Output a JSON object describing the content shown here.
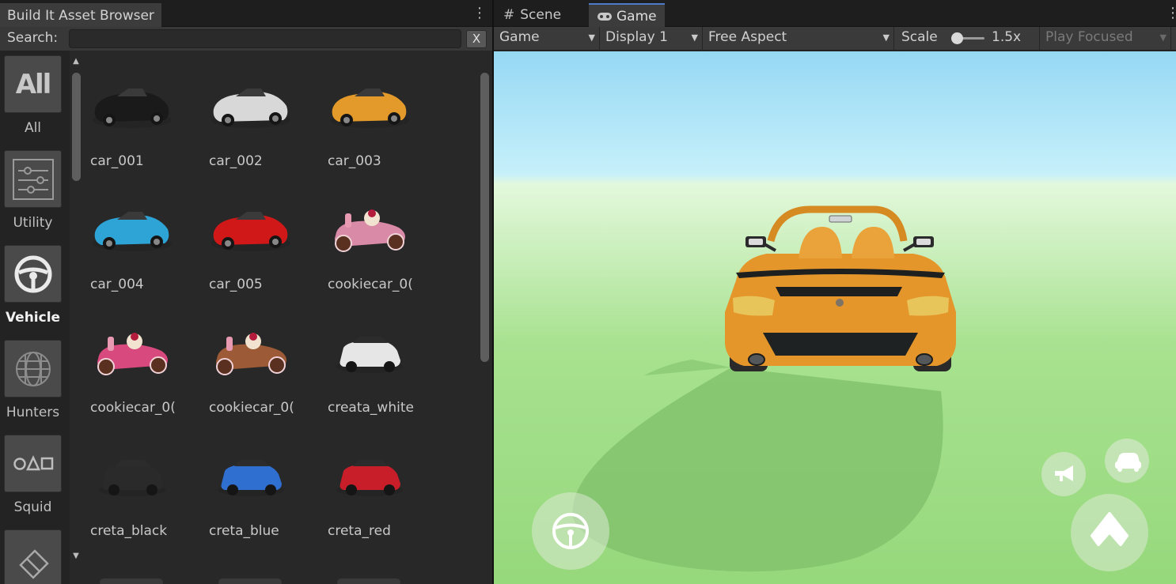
{
  "asset_browser": {
    "tab_title": "Build It Asset Browser",
    "search_label": "Search:",
    "search_value": "",
    "clear_label": "X",
    "categories": [
      {
        "label": "All",
        "icon": "all-text-icon",
        "icon_text": "All",
        "active": false
      },
      {
        "label": "Utility",
        "icon": "sliders-icon",
        "active": false
      },
      {
        "label": "Vehicle",
        "icon": "steering-wheel-icon",
        "active": true
      },
      {
        "label": "Hunters",
        "icon": "globe-grid-icon",
        "active": false
      },
      {
        "label": "Squid",
        "icon": "circle-triangle-square-icon",
        "active": false
      },
      {
        "label": "",
        "icon": "eraser-icon",
        "active": false
      }
    ],
    "assets": [
      {
        "name": "car_001",
        "body": "#1a1a1a",
        "kind": "roadster"
      },
      {
        "name": "car_002",
        "body": "#d8d8d8",
        "kind": "roadster"
      },
      {
        "name": "car_003",
        "body": "#e39a2a",
        "kind": "roadster"
      },
      {
        "name": "car_004",
        "body": "#2ea3d5",
        "kind": "roadster"
      },
      {
        "name": "car_005",
        "body": "#d01818",
        "kind": "roadster"
      },
      {
        "name": "cookiecar_0(",
        "body": "#d98aa6",
        "kind": "cookie"
      },
      {
        "name": "cookiecar_0(",
        "body": "#d84a7e",
        "kind": "cookie"
      },
      {
        "name": "cookiecar_0(",
        "body": "#9c5a36",
        "kind": "cookie"
      },
      {
        "name": "creata_white",
        "body": "#e6e6e6",
        "kind": "suv"
      },
      {
        "name": "creta_black",
        "body": "#2a2a2a",
        "kind": "suv"
      },
      {
        "name": "creta_blue",
        "body": "#2e6fd0",
        "kind": "suv"
      },
      {
        "name": "creta_red",
        "body": "#c81e2a",
        "kind": "suv"
      }
    ]
  },
  "game_view": {
    "tabs": [
      {
        "label": "Scene",
        "icon": "grid-hash-icon",
        "active": false
      },
      {
        "label": "Game",
        "icon": "gamepad-icon",
        "active": true
      }
    ],
    "toolbar": {
      "view_select": "Game",
      "display_select": "Display 1",
      "aspect_select": "Free Aspect",
      "scale_label": "Scale",
      "scale_value": "1.5x",
      "scale_slider_fraction": 0.05,
      "play_mode_select": "Play Focused"
    },
    "colors": {
      "car_body": "#e5962a",
      "sky": "#a8e2f6",
      "ground": "#a6e08e"
    },
    "hud_icons": [
      "steering-wheel-icon",
      "horn-icon",
      "car-swap-icon",
      "accelerate-arrow-icon"
    ]
  }
}
